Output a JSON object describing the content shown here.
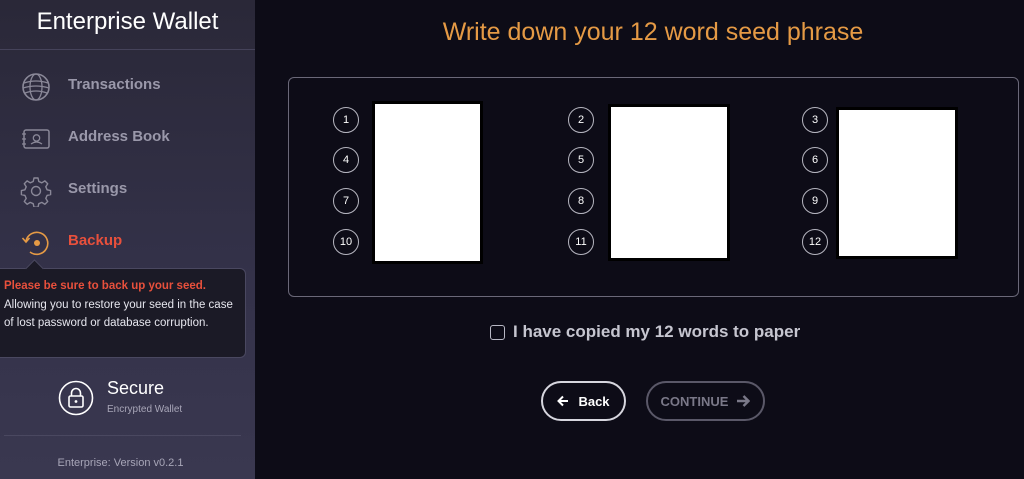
{
  "sidebar": {
    "title": "Enterprise Wallet",
    "items": [
      {
        "label": "Transactions",
        "icon": "globe-icon",
        "active": false
      },
      {
        "label": "Address Book",
        "icon": "address-book-icon",
        "active": false
      },
      {
        "label": "Settings",
        "icon": "gear-icon",
        "active": false
      },
      {
        "label": "Backup",
        "icon": "backup-icon",
        "active": true
      }
    ],
    "tooltip": {
      "warning": "Please be sure to back up your seed.",
      "body": "Allowing you to restore your seed in the case of lost password or database corruption."
    },
    "secure": {
      "title": "Secure",
      "subtitle": "Encrypted Wallet",
      "icon": "lock-icon"
    },
    "version": "Enterprise: Version v0.2.1"
  },
  "main": {
    "heading": "Write down your 12 word seed phrase",
    "columns": [
      {
        "numbers": [
          "1",
          "4",
          "7",
          "10"
        ]
      },
      {
        "numbers": [
          "2",
          "5",
          "8",
          "11"
        ]
      },
      {
        "numbers": [
          "3",
          "6",
          "9",
          "12"
        ]
      }
    ],
    "confirm_label": "I have copied my 12 words to paper",
    "confirm_checked": false,
    "back_label": "Back",
    "continue_label": "CONTINUE"
  },
  "colors": {
    "accent_orange": "#e59a45",
    "active_red": "#e8503c",
    "background": "#0d0c17"
  }
}
